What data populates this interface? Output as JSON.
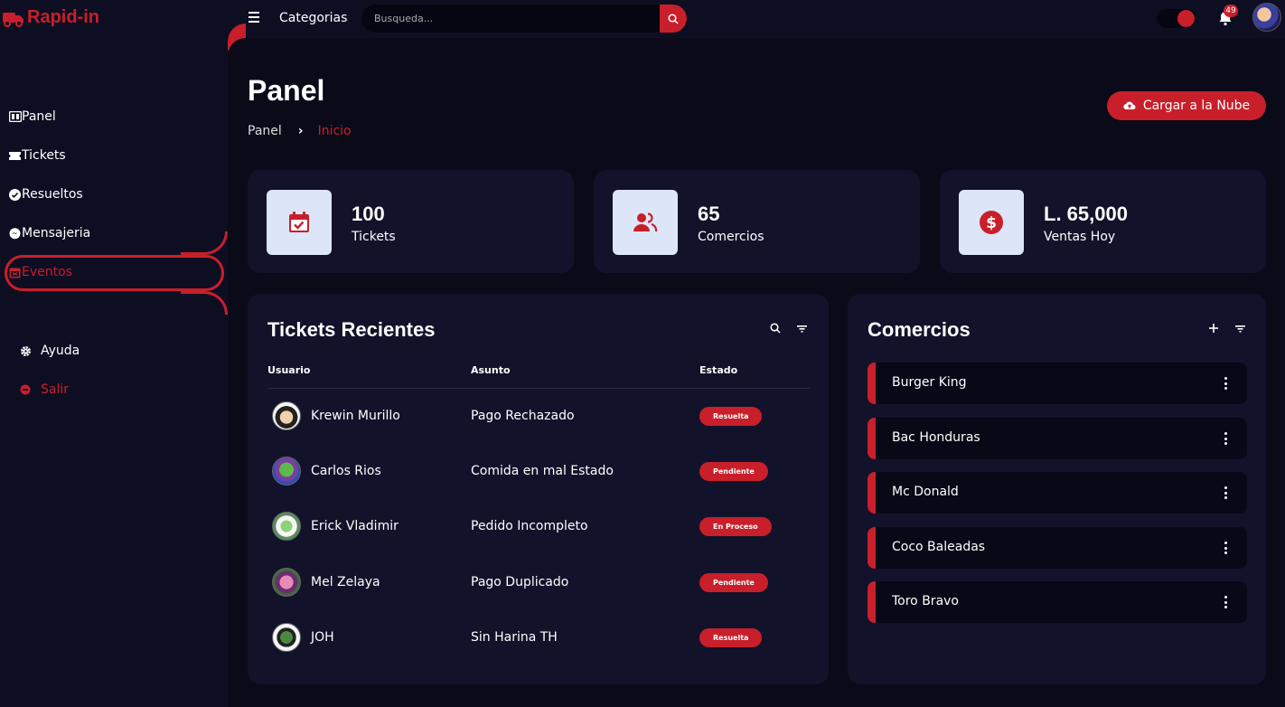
{
  "brand": "Rapid-in",
  "sidebar": {
    "items": [
      {
        "label": "Panel",
        "icon": "panel-icon"
      },
      {
        "label": "Tickets",
        "icon": "ticket-icon"
      },
      {
        "label": "Resueltos",
        "icon": "check-circle-icon"
      },
      {
        "label": "Mensajeria",
        "icon": "messenger-icon"
      },
      {
        "label": "Eventos",
        "icon": "calendar-icon",
        "active": true
      }
    ],
    "help_label": "Ayuda",
    "logout_label": "Salir"
  },
  "topbar": {
    "categories_label": "Categorias",
    "search_placeholder": "Busqueda...",
    "notification_count": "49"
  },
  "page": {
    "title": "Panel",
    "breadcrumb": [
      "Panel",
      "Inicio"
    ],
    "cloud_button": "Cargar a la Nube"
  },
  "stats": [
    {
      "value": "100",
      "label": "Tickets"
    },
    {
      "value": "65",
      "label": "Comercios"
    },
    {
      "value": "L. 65,000",
      "label": "Ventas Hoy"
    }
  ],
  "tickets": {
    "title": "Tickets Recientes",
    "columns": [
      "Usuario",
      "Asunto",
      "Estado"
    ],
    "rows": [
      {
        "user": "Krewin Murillo",
        "subject": "Pago Rechazado",
        "status": "Resuelta"
      },
      {
        "user": "Carlos Rios",
        "subject": "Comida en mal Estado",
        "status": "Pendiente"
      },
      {
        "user": "Erick Vladimir",
        "subject": "Pedido Incompleto",
        "status": "En Proceso"
      },
      {
        "user": "Mel Zelaya",
        "subject": "Pago Duplicado",
        "status": "Pendiente"
      },
      {
        "user": "JOH",
        "subject": "Sin Harina TH",
        "status": "Resuelta"
      }
    ]
  },
  "comercios": {
    "title": "Comercios",
    "items": [
      "Burger King",
      "Bac Honduras",
      "Mc Donald",
      "Coco Baleadas",
      "Toro Bravo"
    ]
  },
  "colors": {
    "accent": "#c81f2b",
    "background": "#0a0a19",
    "card": "#12122a",
    "icon_box": "#dce6f8"
  }
}
